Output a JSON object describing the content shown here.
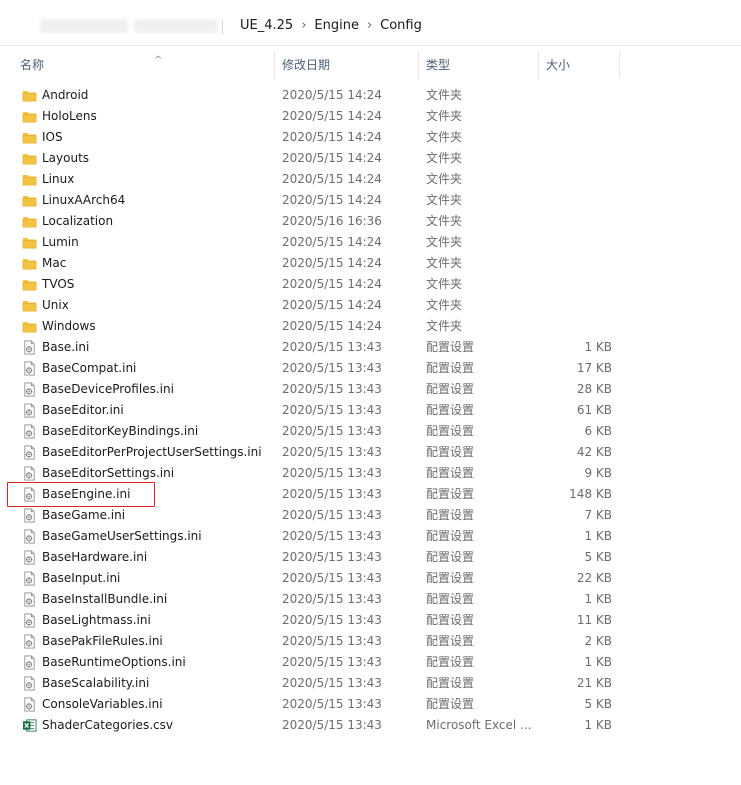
{
  "breadcrumb": {
    "items": [
      "UE_4.25",
      "Engine",
      "Config"
    ]
  },
  "columns": {
    "name": "名称",
    "date": "修改日期",
    "type": "类型",
    "size": "大小"
  },
  "colors": {
    "folder": "#f5c342",
    "highlight": "#d9262b",
    "excel": "#1d7044"
  },
  "files": [
    {
      "name": "Android",
      "date": "2020/5/15 14:24",
      "type": "文件夹",
      "size": "",
      "icon": "folder-icon"
    },
    {
      "name": "HoloLens",
      "date": "2020/5/15 14:24",
      "type": "文件夹",
      "size": "",
      "icon": "folder-icon"
    },
    {
      "name": "IOS",
      "date": "2020/5/15 14:24",
      "type": "文件夹",
      "size": "",
      "icon": "folder-icon"
    },
    {
      "name": "Layouts",
      "date": "2020/5/15 14:24",
      "type": "文件夹",
      "size": "",
      "icon": "folder-icon"
    },
    {
      "name": "Linux",
      "date": "2020/5/15 14:24",
      "type": "文件夹",
      "size": "",
      "icon": "folder-icon"
    },
    {
      "name": "LinuxAArch64",
      "date": "2020/5/15 14:24",
      "type": "文件夹",
      "size": "",
      "icon": "folder-icon"
    },
    {
      "name": "Localization",
      "date": "2020/5/16 16:36",
      "type": "文件夹",
      "size": "",
      "icon": "folder-icon"
    },
    {
      "name": "Lumin",
      "date": "2020/5/15 14:24",
      "type": "文件夹",
      "size": "",
      "icon": "folder-icon"
    },
    {
      "name": "Mac",
      "date": "2020/5/15 14:24",
      "type": "文件夹",
      "size": "",
      "icon": "folder-icon"
    },
    {
      "name": "TVOS",
      "date": "2020/5/15 14:24",
      "type": "文件夹",
      "size": "",
      "icon": "folder-icon"
    },
    {
      "name": "Unix",
      "date": "2020/5/15 14:24",
      "type": "文件夹",
      "size": "",
      "icon": "folder-icon"
    },
    {
      "name": "Windows",
      "date": "2020/5/15 14:24",
      "type": "文件夹",
      "size": "",
      "icon": "folder-icon"
    },
    {
      "name": "Base.ini",
      "date": "2020/5/15 13:43",
      "type": "配置设置",
      "size": "1 KB",
      "icon": "ini-file-icon"
    },
    {
      "name": "BaseCompat.ini",
      "date": "2020/5/15 13:43",
      "type": "配置设置",
      "size": "17 KB",
      "icon": "ini-file-icon"
    },
    {
      "name": "BaseDeviceProfiles.ini",
      "date": "2020/5/15 13:43",
      "type": "配置设置",
      "size": "28 KB",
      "icon": "ini-file-icon"
    },
    {
      "name": "BaseEditor.ini",
      "date": "2020/5/15 13:43",
      "type": "配置设置",
      "size": "61 KB",
      "icon": "ini-file-icon"
    },
    {
      "name": "BaseEditorKeyBindings.ini",
      "date": "2020/5/15 13:43",
      "type": "配置设置",
      "size": "6 KB",
      "icon": "ini-file-icon"
    },
    {
      "name": "BaseEditorPerProjectUserSettings.ini",
      "date": "2020/5/15 13:43",
      "type": "配置设置",
      "size": "42 KB",
      "icon": "ini-file-icon"
    },
    {
      "name": "BaseEditorSettings.ini",
      "date": "2020/5/15 13:43",
      "type": "配置设置",
      "size": "9 KB",
      "icon": "ini-file-icon"
    },
    {
      "name": "BaseEngine.ini",
      "date": "2020/5/15 13:43",
      "type": "配置设置",
      "size": "148 KB",
      "icon": "ini-file-icon",
      "highlighted": true
    },
    {
      "name": "BaseGame.ini",
      "date": "2020/5/15 13:43",
      "type": "配置设置",
      "size": "7 KB",
      "icon": "ini-file-icon"
    },
    {
      "name": "BaseGameUserSettings.ini",
      "date": "2020/5/15 13:43",
      "type": "配置设置",
      "size": "1 KB",
      "icon": "ini-file-icon"
    },
    {
      "name": "BaseHardware.ini",
      "date": "2020/5/15 13:43",
      "type": "配置设置",
      "size": "5 KB",
      "icon": "ini-file-icon"
    },
    {
      "name": "BaseInput.ini",
      "date": "2020/5/15 13:43",
      "type": "配置设置",
      "size": "22 KB",
      "icon": "ini-file-icon"
    },
    {
      "name": "BaseInstallBundle.ini",
      "date": "2020/5/15 13:43",
      "type": "配置设置",
      "size": "1 KB",
      "icon": "ini-file-icon"
    },
    {
      "name": "BaseLightmass.ini",
      "date": "2020/5/15 13:43",
      "type": "配置设置",
      "size": "11 KB",
      "icon": "ini-file-icon"
    },
    {
      "name": "BasePakFileRules.ini",
      "date": "2020/5/15 13:43",
      "type": "配置设置",
      "size": "2 KB",
      "icon": "ini-file-icon"
    },
    {
      "name": "BaseRuntimeOptions.ini",
      "date": "2020/5/15 13:43",
      "type": "配置设置",
      "size": "1 KB",
      "icon": "ini-file-icon"
    },
    {
      "name": "BaseScalability.ini",
      "date": "2020/5/15 13:43",
      "type": "配置设置",
      "size": "21 KB",
      "icon": "ini-file-icon"
    },
    {
      "name": "ConsoleVariables.ini",
      "date": "2020/5/15 13:43",
      "type": "配置设置",
      "size": "5 KB",
      "icon": "ini-file-icon"
    },
    {
      "name": "ShaderCategories.csv",
      "date": "2020/5/15 13:43",
      "type": "Microsoft Excel ...",
      "size": "1 KB",
      "icon": "excel-csv-icon"
    }
  ]
}
